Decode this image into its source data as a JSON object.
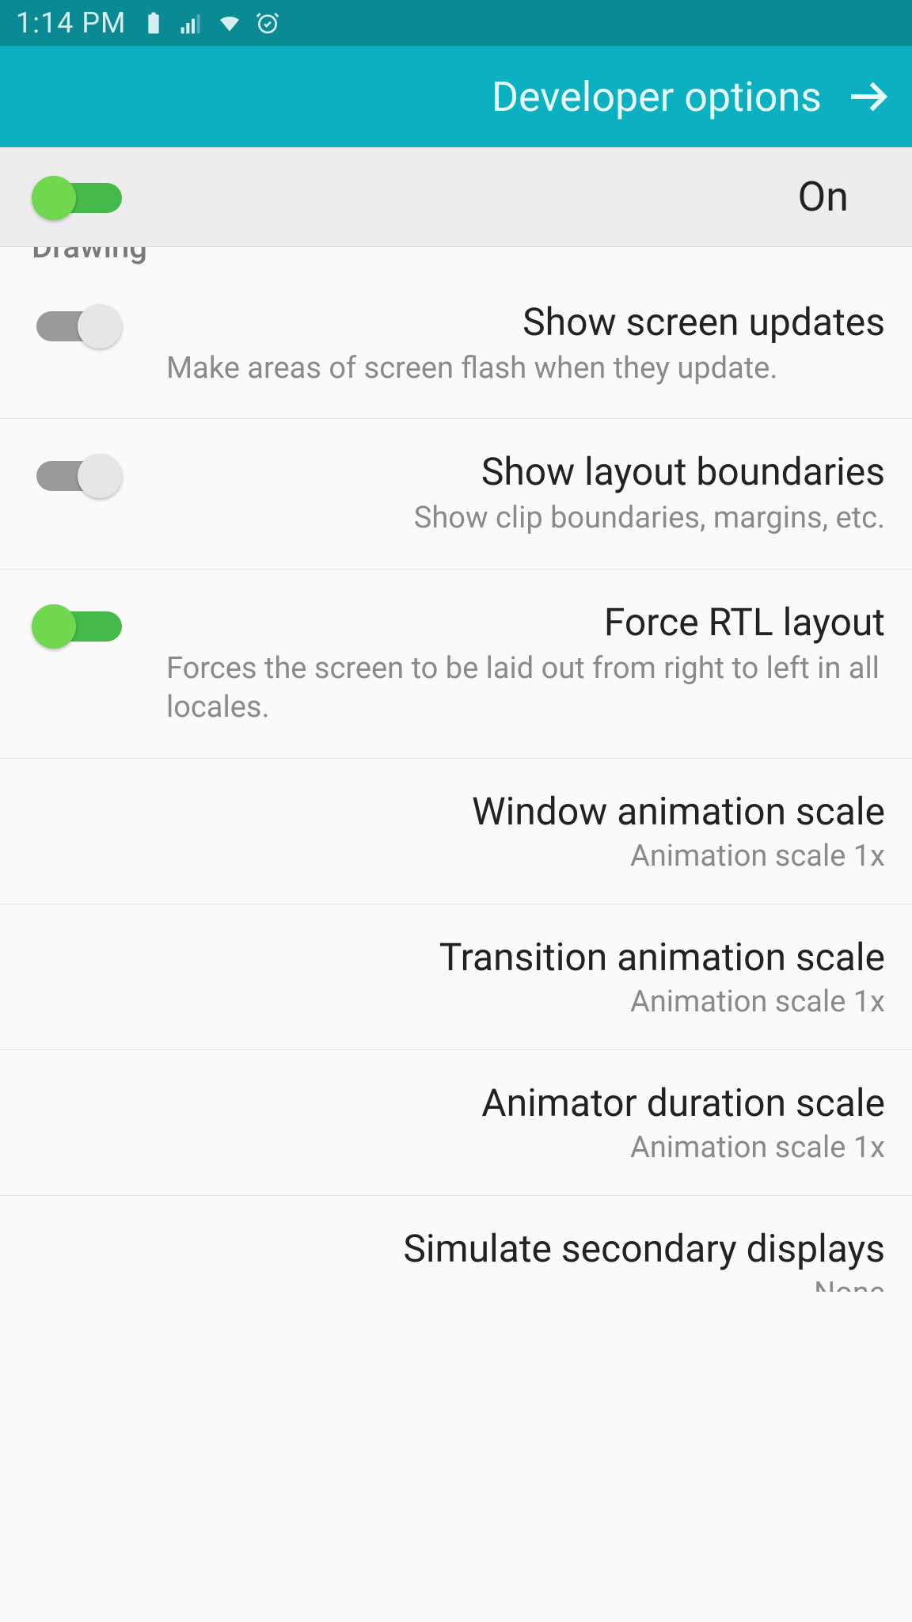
{
  "status": {
    "time": "1:14 PM"
  },
  "header": {
    "title": "Developer options"
  },
  "master": {
    "label": "On",
    "enabled": true
  },
  "section": {
    "label": "Drawing"
  },
  "items": [
    {
      "key": "show-screen-updates",
      "title": "Show screen updates",
      "sub": "Make areas of screen flash when they update.",
      "toggle": false,
      "has_toggle": true
    },
    {
      "key": "show-layout-boundaries",
      "title": "Show layout boundaries",
      "sub": "Show clip boundaries, margins, etc.",
      "toggle": false,
      "has_toggle": true
    },
    {
      "key": "force-rtl-layout",
      "title": "Force RTL layout",
      "sub": "Forces the screen to be laid out from right to left in all locales.",
      "toggle": true,
      "has_toggle": true
    },
    {
      "key": "window-animation-scale",
      "title": "Window animation scale",
      "value": "Animation scale 1x",
      "has_toggle": false
    },
    {
      "key": "transition-animation-scale",
      "title": "Transition animation scale",
      "value": "Animation scale 1x",
      "has_toggle": false
    },
    {
      "key": "animator-duration-scale",
      "title": "Animator duration scale",
      "value": "Animation scale 1x",
      "has_toggle": false
    },
    {
      "key": "simulate-secondary-displays",
      "title": "Simulate secondary displays",
      "value": "None",
      "has_toggle": false
    }
  ]
}
